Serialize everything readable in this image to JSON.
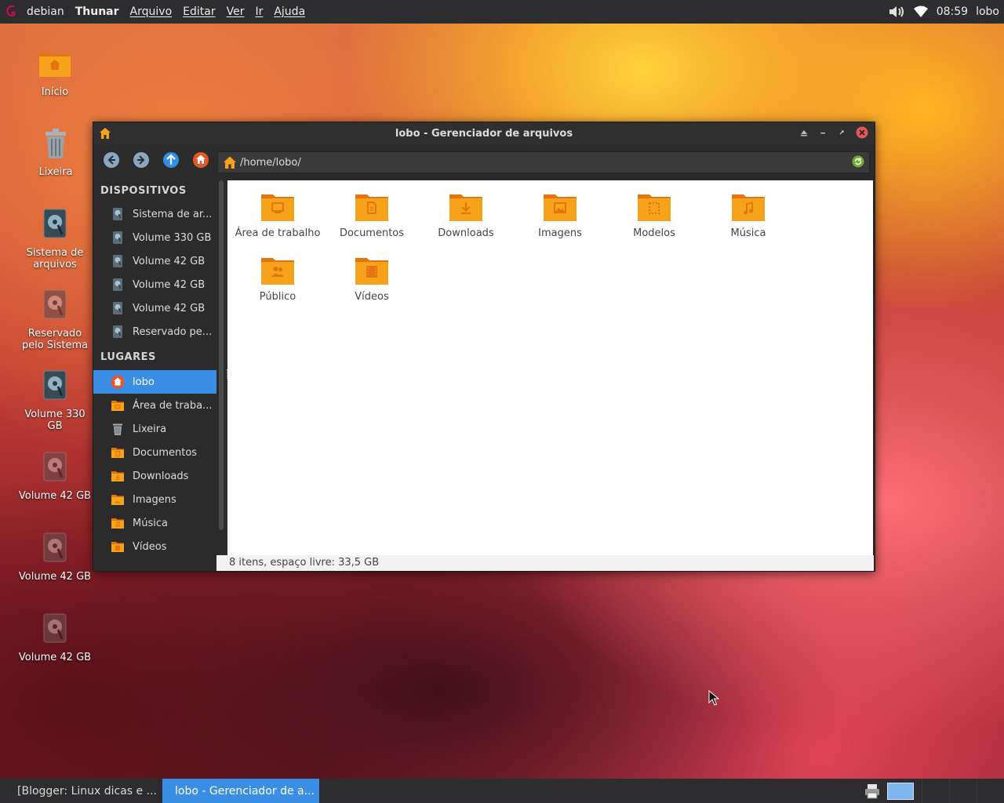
{
  "top_panel": {
    "distro": "debian",
    "app_name": "Thunar",
    "menus": [
      "Arquivo",
      "Editar",
      "Ver",
      "Ir",
      "Ajuda"
    ],
    "clock": "08:59",
    "user": "lobo"
  },
  "desktop_icons": [
    {
      "label": "Início"
    },
    {
      "label": "Lixeira"
    },
    {
      "label": "Sistema de arquivos"
    },
    {
      "label": "Reservado pelo Sistema"
    },
    {
      "label": "Volume 330 GB"
    },
    {
      "label": "Volume 42 GB"
    },
    {
      "label": "Volume 42 GB"
    },
    {
      "label": "Volume 42 GB"
    }
  ],
  "window": {
    "title": "lobo - Gerenciador de arquivos",
    "location": "/home/lobo/",
    "sidebar": {
      "devices_header": "DISPOSITIVOS",
      "devices": [
        "Sistema de ar...",
        "Volume 330 GB",
        "Volume 42 GB",
        "Volume 42 GB",
        "Volume 42 GB",
        "Reservado pe..."
      ],
      "places_header": "LUGARES",
      "places": [
        {
          "label": "lobo",
          "icon": "home-icon"
        },
        {
          "label": "Área de traba...",
          "icon": "desktop-folder-icon"
        },
        {
          "label": "Lixeira",
          "icon": "trash-icon"
        },
        {
          "label": "Documentos",
          "icon": "documents-folder-icon"
        },
        {
          "label": "Downloads",
          "icon": "downloads-folder-icon"
        },
        {
          "label": "Imagens",
          "icon": "pictures-folder-icon"
        },
        {
          "label": "Música",
          "icon": "music-folder-icon"
        },
        {
          "label": "Vídeos",
          "icon": "videos-folder-icon"
        }
      ]
    },
    "files": [
      {
        "label": "Área de trabalho",
        "icon": "desktop-folder-icon"
      },
      {
        "label": "Documentos",
        "icon": "documents-folder-icon"
      },
      {
        "label": "Downloads",
        "icon": "downloads-folder-icon"
      },
      {
        "label": "Imagens",
        "icon": "pictures-folder-icon"
      },
      {
        "label": "Modelos",
        "icon": "templates-folder-icon"
      },
      {
        "label": "Música",
        "icon": "music-folder-icon"
      },
      {
        "label": "Público",
        "icon": "public-folder-icon"
      },
      {
        "label": "Vídeos",
        "icon": "videos-folder-icon"
      }
    ],
    "status": "8 itens, espaço livre: 33,5 GB"
  },
  "taskbar": {
    "tasks": [
      {
        "label": "[Blogger: Linux dicas e ...",
        "active": false
      },
      {
        "label": "lobo - Gerenciador de a...",
        "active": true
      }
    ]
  },
  "colors": {
    "accent": "#3b8ee5",
    "folder": "#f7a21b",
    "folder_dark": "#e4740f"
  }
}
